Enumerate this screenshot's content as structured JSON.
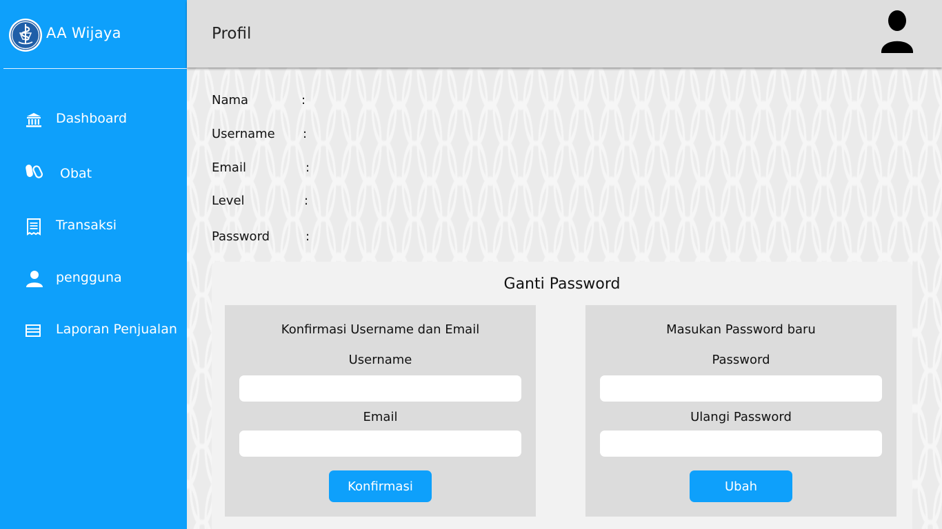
{
  "brand": {
    "name": "AA Wijaya",
    "logo_icon": "pharmacy-caduceus-logo"
  },
  "sidebar": {
    "items": [
      {
        "label": "Dashboard",
        "icon": "bank-icon"
      },
      {
        "label": "Obat",
        "icon": "pills-icon"
      },
      {
        "label": "Transaksi",
        "icon": "receipt-icon"
      },
      {
        "label": "pengguna",
        "icon": "user-icon"
      },
      {
        "label": "Laporan Penjualan",
        "icon": "report-icon"
      }
    ]
  },
  "header": {
    "title": "Profil",
    "avatar_icon": "user-avatar-icon"
  },
  "profile": {
    "fields": [
      {
        "label": "Nama",
        "sep": ":"
      },
      {
        "label": "Username",
        "sep": ":"
      },
      {
        "label": "Email",
        "sep": ":"
      },
      {
        "label": "Level",
        "sep": ":"
      },
      {
        "label": "Password",
        "sep": ":"
      }
    ]
  },
  "change_password": {
    "title": "Ganti Password",
    "confirm_panel": {
      "title": "Konfirmasi Username dan Email",
      "username_label": "Username",
      "username_value": "",
      "email_label": "Email",
      "email_value": "",
      "button": "Konfirmasi"
    },
    "new_panel": {
      "title": "Masukan Password baru",
      "password_label": "Password",
      "password_value": "",
      "repeat_label": "Ulangi Password",
      "repeat_value": "",
      "button": "Ubah"
    }
  },
  "colors": {
    "primary": "#0ea0fb",
    "topbar": "#dedede",
    "card": "#f2f2f2",
    "panel": "#dcdcdc"
  }
}
